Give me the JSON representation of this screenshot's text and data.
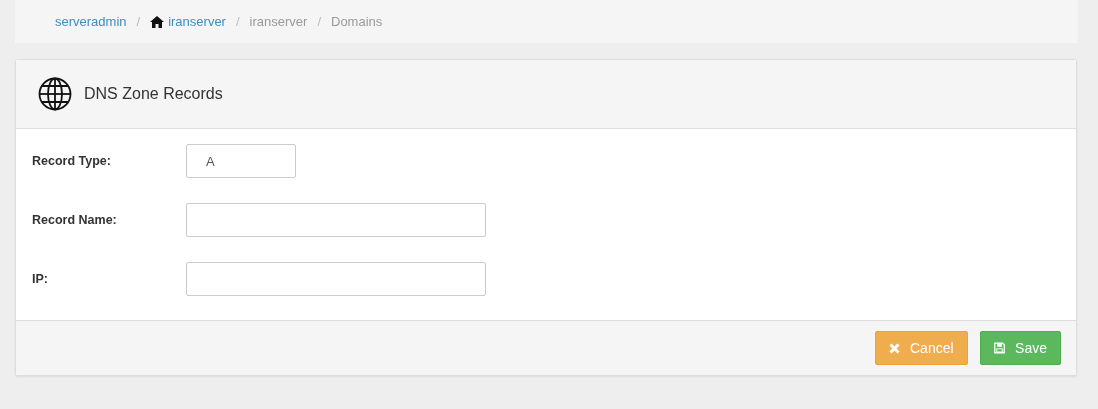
{
  "breadcrumb": [
    {
      "label": "serveradmin",
      "kind": "link"
    },
    {
      "separator": "/",
      "label": "iranserver",
      "kind": "home-link"
    },
    {
      "separator": "/",
      "label": "iranserver",
      "kind": "text"
    },
    {
      "separator": "/",
      "label": "Domains",
      "kind": "text"
    }
  ],
  "panel": {
    "title": "DNS Zone Records",
    "fields": [
      {
        "label": "Record Type:",
        "value": "A",
        "kind": "short"
      },
      {
        "label": "Record Name:",
        "kind": "wide"
      },
      {
        "label": "IP:",
        "kind": "wide"
      }
    ],
    "buttons": [
      {
        "label": "Cancel",
        "kind": "cancel"
      },
      {
        "label": "Save",
        "kind": "save"
      }
    ]
  }
}
